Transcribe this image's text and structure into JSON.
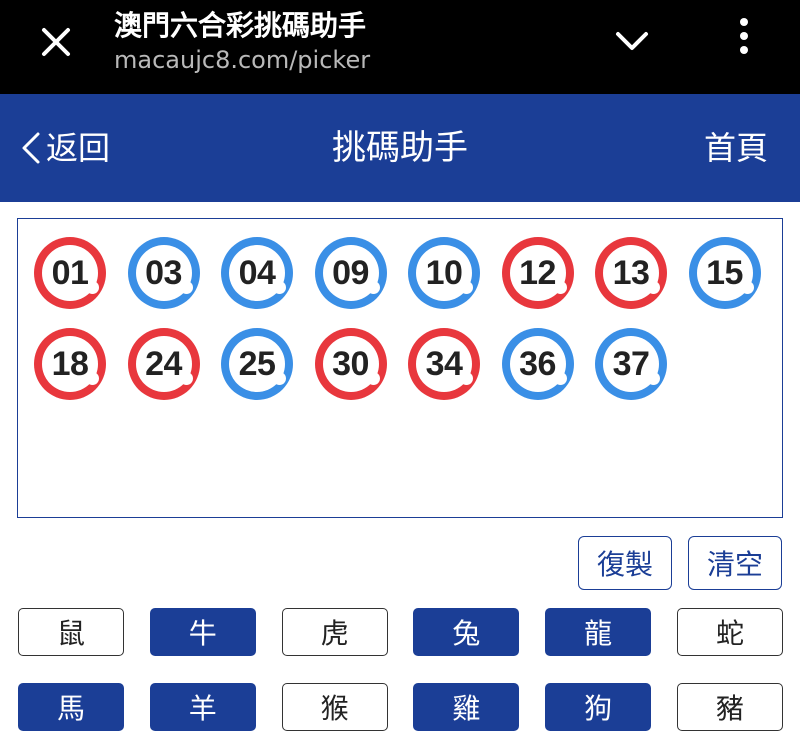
{
  "browser": {
    "title": "澳門六合彩挑碼助手",
    "url": "macaujc8.com/picker"
  },
  "header": {
    "back_label": "返回",
    "title": "挑碼助手",
    "home_label": "首頁"
  },
  "picked_numbers": [
    {
      "num": "01",
      "color": "red"
    },
    {
      "num": "03",
      "color": "blue"
    },
    {
      "num": "04",
      "color": "blue"
    },
    {
      "num": "09",
      "color": "blue"
    },
    {
      "num": "10",
      "color": "blue"
    },
    {
      "num": "12",
      "color": "red"
    },
    {
      "num": "13",
      "color": "red"
    },
    {
      "num": "15",
      "color": "blue"
    },
    {
      "num": "18",
      "color": "red"
    },
    {
      "num": "24",
      "color": "red"
    },
    {
      "num": "25",
      "color": "blue"
    },
    {
      "num": "30",
      "color": "red"
    },
    {
      "num": "34",
      "color": "red"
    },
    {
      "num": "36",
      "color": "blue"
    },
    {
      "num": "37",
      "color": "blue"
    }
  ],
  "actions": {
    "copy_label": "復製",
    "clear_label": "清空"
  },
  "zodiac": [
    {
      "label": "鼠",
      "selected": false
    },
    {
      "label": "牛",
      "selected": true
    },
    {
      "label": "虎",
      "selected": false
    },
    {
      "label": "兔",
      "selected": true
    },
    {
      "label": "龍",
      "selected": true
    },
    {
      "label": "蛇",
      "selected": false
    },
    {
      "label": "馬",
      "selected": true
    },
    {
      "label": "羊",
      "selected": true
    },
    {
      "label": "猴",
      "selected": false
    },
    {
      "label": "雞",
      "selected": true
    },
    {
      "label": "狗",
      "selected": true
    },
    {
      "label": "豬",
      "selected": false
    }
  ],
  "colors": {
    "brand_blue": "#1b3e96",
    "ball_red": "#e8373d",
    "ball_blue": "#3a8fe6"
  }
}
